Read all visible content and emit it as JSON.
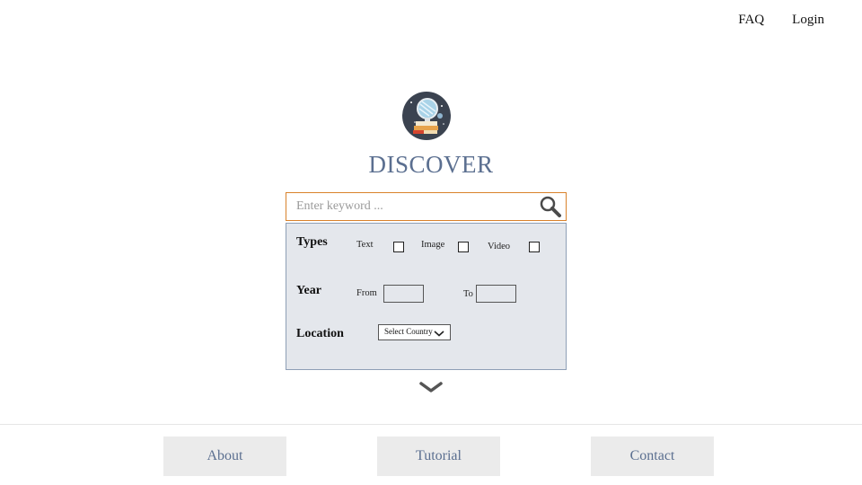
{
  "nav": {
    "faq": "FAQ",
    "login": "Login"
  },
  "title": "DISCOVER",
  "search": {
    "placeholder": "Enter keyword ...",
    "value": ""
  },
  "filters": {
    "types_label": "Types",
    "types": [
      {
        "label": "Text",
        "checked": false
      },
      {
        "label": "Image",
        "checked": false
      },
      {
        "label": "Video",
        "checked": false
      }
    ],
    "year_label": "Year",
    "year_from_label": "From",
    "year_to_label": "To",
    "year_from_value": "",
    "year_to_value": "",
    "location_label": "Location",
    "location_select": "Select Country"
  },
  "footer": {
    "about": "About",
    "tutorial": "Tutorial",
    "contact": "Contact"
  },
  "icons": {
    "logo": "globe-on-books-icon",
    "search": "magnifier-icon",
    "dropdown": "chevron-down-icon",
    "expand": "chevron-down-icon"
  },
  "colors": {
    "accent_border": "#d9822b",
    "title_blue": "#5b6f90",
    "panel_bg": "#e4e7ec",
    "panel_border": "#8e9fb6",
    "footer_button_bg": "#ebebeb"
  }
}
